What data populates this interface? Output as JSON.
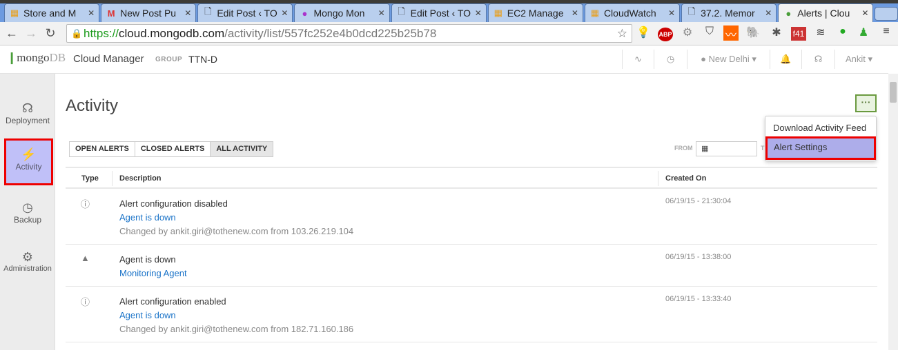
{
  "browser": {
    "tabs": [
      {
        "icon": "box-icon",
        "label": "Store and M",
        "active": false
      },
      {
        "icon": "gmail-icon",
        "label": "New Post Pu",
        "active": false
      },
      {
        "icon": "page-icon",
        "label": "Edit Post ‹ TO",
        "active": false
      },
      {
        "icon": "mongo-monitor-icon",
        "label": "Mongo Mon",
        "active": false
      },
      {
        "icon": "page-icon",
        "label": "Edit Post ‹ TO",
        "active": false
      },
      {
        "icon": "box-icon",
        "label": "EC2 Manage",
        "active": false
      },
      {
        "icon": "box-icon",
        "label": "CloudWatch",
        "active": false
      },
      {
        "icon": "page-icon",
        "label": "37.2. Memor",
        "active": false
      },
      {
        "icon": "leaf-icon",
        "label": "Alerts | Clou",
        "active": true
      }
    ],
    "url_scheme": "https://",
    "url_host": "cloud.mongodb.com",
    "url_path": "/activity/list/557fc252e4b0dcd225b25b78",
    "extensions": [
      "bulb-icon",
      "adblock-icon",
      "film-icon",
      "pocket-icon",
      "analytics-icon",
      "evernote-icon",
      "bug-icon",
      "f41-icon",
      "buffer-icon",
      "whatsapp-icon",
      "people-icon",
      "menu-icon"
    ],
    "ext_labels": {
      "abp": "ABP",
      "f41": "f41"
    }
  },
  "header": {
    "logo_mongo": "mongo",
    "logo_db": "DB",
    "product": "Cloud Manager",
    "group_label": "GROUP",
    "group_name": "TTN-D",
    "location": "New Delhi",
    "user": "Ankit"
  },
  "sidebar": {
    "items": [
      {
        "label": "Deployment",
        "icon": "deployment-icon"
      },
      {
        "label": "Activity",
        "icon": "lightning-icon",
        "active": true
      },
      {
        "label": "Backup",
        "icon": "history-icon"
      },
      {
        "label": "Administration",
        "icon": "gear-icon"
      }
    ]
  },
  "main": {
    "title": "Activity",
    "more_label": "···",
    "menu": [
      "Download Activity Feed",
      "Alert Settings"
    ],
    "filters": [
      "OPEN ALERTS",
      "CLOSED ALERTS",
      "ALL ACTIVITY"
    ],
    "active_filter": "ALL ACTIVITY",
    "from_label": "FROM",
    "to_label": "T",
    "columns": [
      "Type",
      "Description",
      "Created On"
    ],
    "rows": [
      {
        "type": "info",
        "title": "Alert configuration disabled",
        "link": "Agent is down",
        "sub": "Changed by ankit.giri@tothenew.com from 103.26.219.104",
        "date": "06/19/15 - 21:30:04"
      },
      {
        "type": "warning",
        "title": "Agent is down",
        "link": "Monitoring Agent",
        "sub": "",
        "date": "06/19/15 - 13:38:00"
      },
      {
        "type": "info",
        "title": "Alert configuration enabled",
        "link": "Agent is down",
        "sub": "Changed by ankit.giri@tothenew.com from 182.71.160.186",
        "date": "06/19/15 - 13:33:40"
      }
    ]
  }
}
